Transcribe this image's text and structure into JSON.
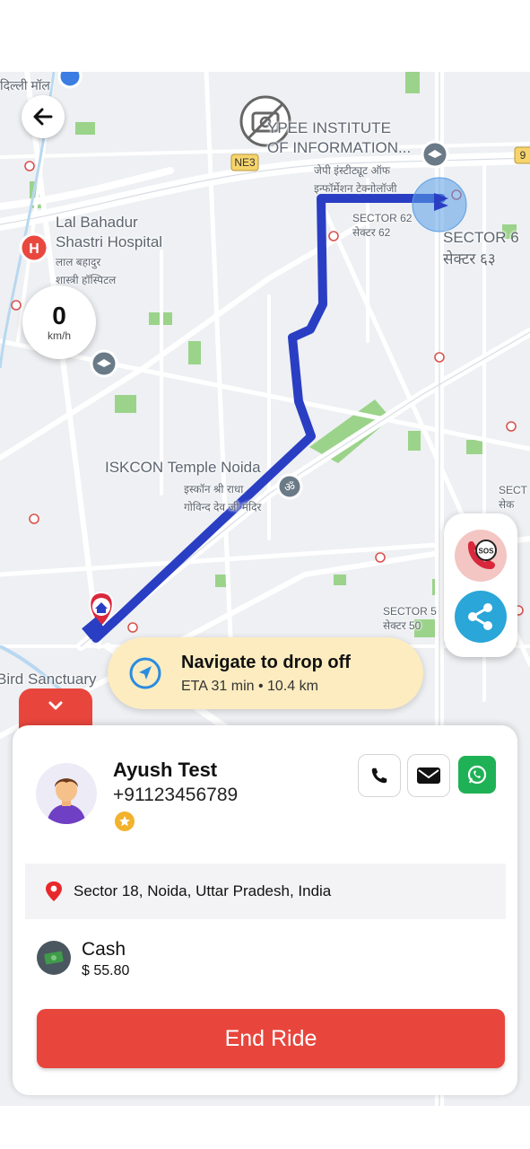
{
  "map": {
    "labels": {
      "jaypee_en": "YPEE INSTITUTE\nOF INFORMATION...",
      "jaypee_hi": "जेपी इंस्टीट्यूट ऑफ\nइन्फॉर्मेशन टेक्नोलॉजी",
      "delhi_mall": "दिल्ली मॉल",
      "hospital_en": "Lal Bahadur\nShastri Hospital",
      "hospital_hi": "लाल बहादुर\nशास्त्री हॉस्पिटल",
      "sector62_small": "SECTOR 62\nसेक्टर 62",
      "sector6x_large": "SECTOR 6\nसेक्टर ६३",
      "iskcon_en": "ISKCON Temple Noida",
      "iskcon_hi": "इस्कॉन श्री राधा\nगोविन्द देव जी मंदिर",
      "sector50": "SECTOR 5\nसेक्टर 50",
      "secto_right": "SECT\nसेक",
      "bird_sanctuary": "Bird Sanctuary",
      "road_ne3": "NE3",
      "road_9": "9"
    }
  },
  "speedometer": {
    "value": "0",
    "unit": "km/h"
  },
  "navigation": {
    "title": "Navigate to drop off",
    "eta": "ETA 31 min • 10.4 km"
  },
  "rider": {
    "name": "Ayush Test",
    "phone": "+91123456789",
    "rating_icon": "star-icon"
  },
  "dropoff": {
    "address": "Sector 18, Noida, Uttar Pradesh, India"
  },
  "payment": {
    "method": "Cash",
    "amount": "$ 55.80"
  },
  "actions": {
    "end_ride": "End Ride",
    "sos": "SOS"
  },
  "colors": {
    "route": "#2a3ec4",
    "primary_red": "#e8463d",
    "nav_pill": "#fcecc0",
    "share_blue": "#2aa6d8",
    "whatsapp": "#1fb155",
    "park_green": "#9bd38a"
  }
}
